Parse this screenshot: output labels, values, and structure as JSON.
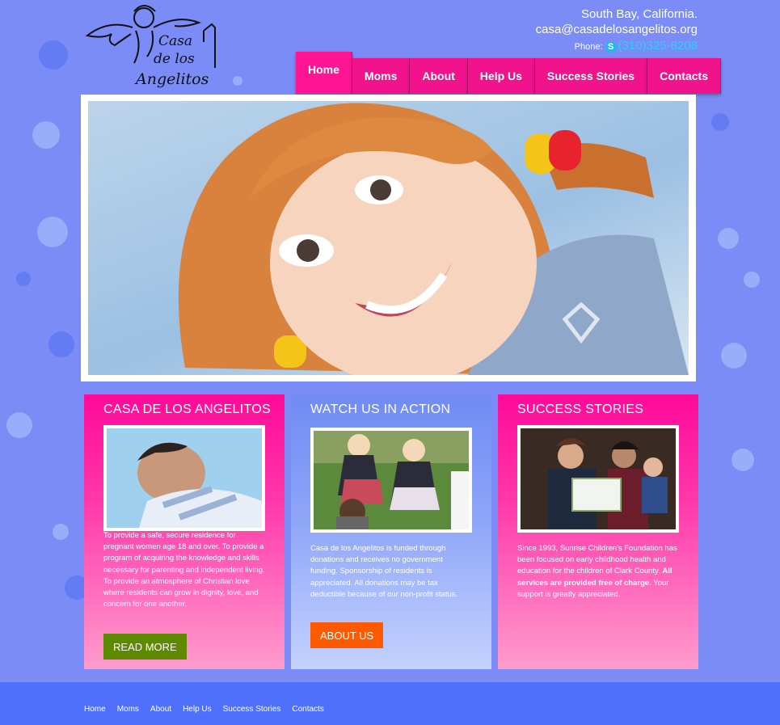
{
  "header": {
    "logo_text": [
      "Casa",
      "de los",
      "Angelitos"
    ],
    "location": "South Bay, California.",
    "email": "casa@casadelosangelitos.org",
    "phone_label": "Phone:",
    "phone": "(310)325-8208",
    "skype_icon": "skype-icon"
  },
  "nav": {
    "items": [
      "Home",
      "Moms",
      "About",
      "Help Us",
      "Success Stories",
      "Contacts"
    ],
    "active": "Home"
  },
  "boxes": {
    "casa": {
      "title": "CASA DE LOS ANGELITOS",
      "text": "To provide a safe, secure residence for pregnant women age 18 and over. To provide a program of acquiring the knowledge and skills necessary for parenting and independent living. To provide an atmosphere of Christian love where residents can grow in dignity, love, and concern for one another.",
      "button": "READ MORE"
    },
    "watch": {
      "title": "WATCH US IN ACTION",
      "text": "Casa de los Angelitos is funded through donations and receives no government funding. Sponsorship of residents is appreciated. All donations may be tax deductible because of our non-profit status.",
      "button": "ABOUT US"
    },
    "success": {
      "title": "SUCCESS STORIES",
      "text_before": "Since 1993, Sunrise Children's Foundation has been focused on early childhood health and education for the children of Clark County.",
      "text_bold": "All services are provided free of charge",
      "text_after": ". Your support is greatly appreciated."
    }
  },
  "footer": {
    "links": [
      "Home",
      "Moms",
      "About",
      "Help Us",
      "Success Stories",
      "Contacts"
    ]
  },
  "colors": {
    "background": "#7b8cf6",
    "pink": "#ff1493",
    "green_button": "#5d8a00",
    "orange_button": "#ff5a00",
    "footer": "#4f70fb"
  }
}
